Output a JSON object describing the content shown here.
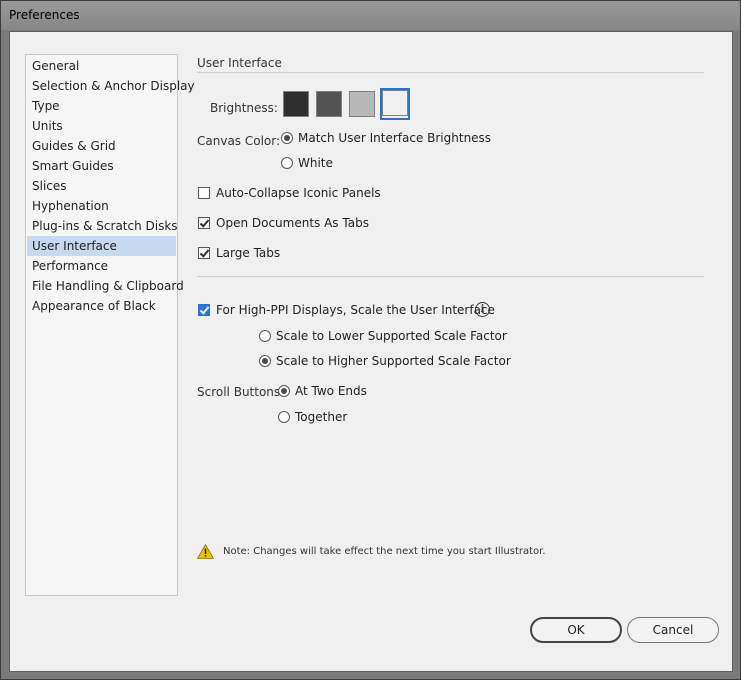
{
  "window": {
    "title": "Preferences"
  },
  "sidebar": {
    "items": [
      {
        "label": "General"
      },
      {
        "label": "Selection & Anchor Display"
      },
      {
        "label": "Type"
      },
      {
        "label": "Units"
      },
      {
        "label": "Guides & Grid"
      },
      {
        "label": "Smart Guides"
      },
      {
        "label": "Slices"
      },
      {
        "label": "Hyphenation"
      },
      {
        "label": "Plug-ins & Scratch Disks"
      },
      {
        "label": "User Interface",
        "selected": true
      },
      {
        "label": "Performance"
      },
      {
        "label": "File Handling & Clipboard"
      },
      {
        "label": "Appearance of Black"
      }
    ]
  },
  "panel": {
    "section_title": "User Interface",
    "brightness": {
      "label": "Brightness:",
      "swatches": [
        "#2f2f2f",
        "#535353",
        "#b8b8b8",
        "#f0f0f0"
      ],
      "selected_index": 3
    },
    "canvas_color": {
      "label": "Canvas Color:",
      "options": [
        {
          "label": "Match User Interface Brightness",
          "checked": true
        },
        {
          "label": "White",
          "checked": false
        }
      ]
    },
    "auto_collapse": {
      "label": "Auto-Collapse Iconic Panels",
      "checked": false
    },
    "open_docs_tabs": {
      "label": "Open Documents As Tabs",
      "checked": true
    },
    "large_tabs": {
      "label": "Large Tabs",
      "checked": true
    },
    "high_ppi": {
      "label": "For High-PPI Displays, Scale the User Interface",
      "checked": true,
      "info_icon": "i",
      "options": [
        {
          "label": "Scale to Lower Supported Scale Factor",
          "checked": false
        },
        {
          "label": "Scale to Higher Supported Scale Factor",
          "checked": true
        }
      ]
    },
    "scroll_buttons": {
      "label": "Scroll Buttons:",
      "options": [
        {
          "label": "At Two Ends",
          "checked": true
        },
        {
          "label": "Together",
          "checked": false
        }
      ]
    },
    "note": "Note:  Changes will take effect the next time you start Illustrator."
  },
  "buttons": {
    "ok": "OK",
    "cancel": "Cancel"
  },
  "colors": {
    "accent": "#2a73c4",
    "selection": "#c5d9ef",
    "warning": "#f2c200"
  }
}
